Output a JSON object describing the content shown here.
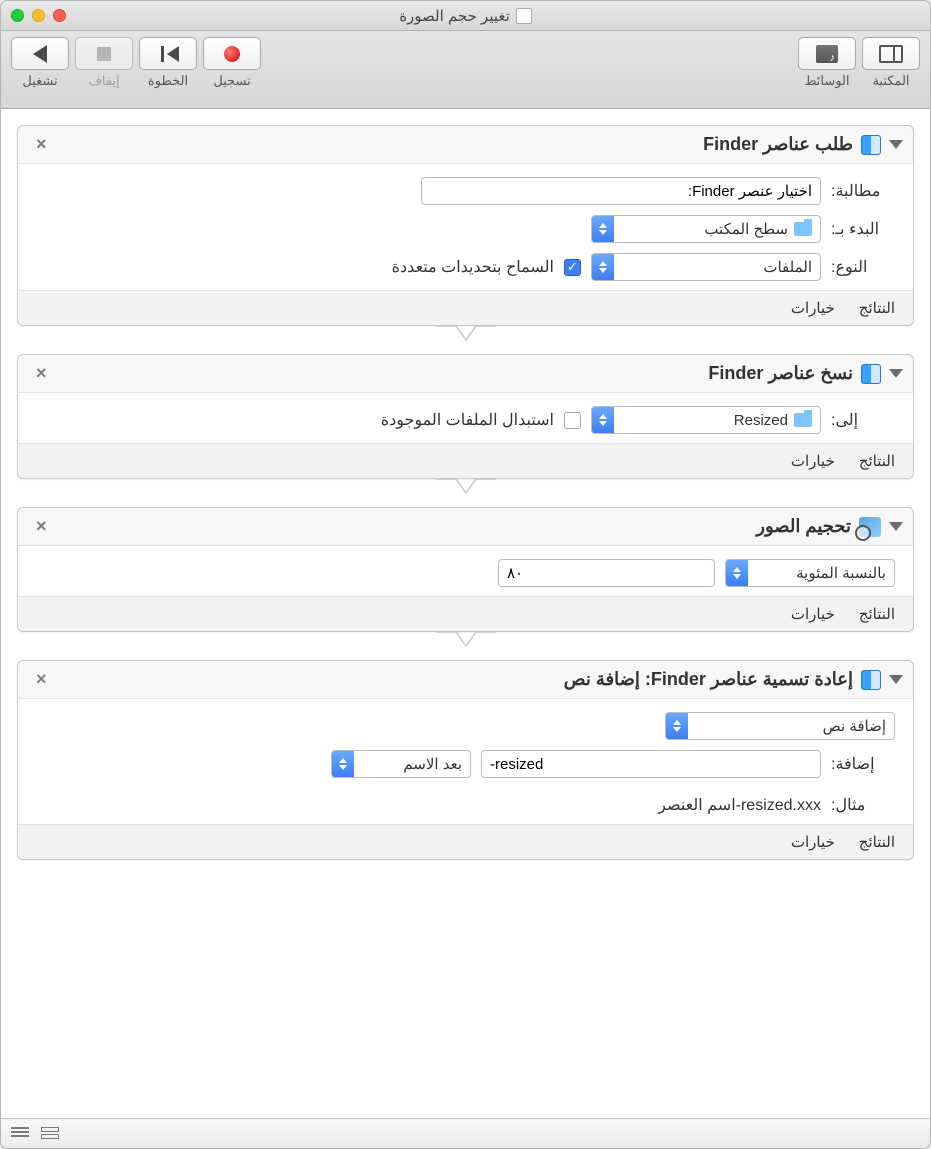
{
  "window": {
    "title": "تغيير حجم الصورة"
  },
  "toolbar": {
    "library": "المكتبة",
    "media": "الوسائط",
    "record": "تسجيل",
    "step": "الخطوة",
    "stop": "إيقاف",
    "run": "تشغيل"
  },
  "actions": [
    {
      "title": "طلب عناصر Finder",
      "icon": "finder",
      "prompt_label": "مطالبة:",
      "prompt_value": "اختيار عنصر Finder:",
      "start_label": "البدء بـ:",
      "start_value": "سطح المكتب",
      "type_label": "النوع:",
      "type_value": "الملفات",
      "allow_multi_label": "السماح بتحديدات متعددة",
      "allow_multi_checked": true,
      "results": "النتائج",
      "options": "خيارات"
    },
    {
      "title": "نسخ عناصر Finder",
      "icon": "finder",
      "to_label": "إلى:",
      "to_value": "Resized",
      "replace_label": "استبدال الملفات الموجودة",
      "replace_checked": false,
      "results": "النتائج",
      "options": "خيارات"
    },
    {
      "title": "تحجيم الصور",
      "icon": "preview",
      "mode_value": "بالنسبة المئوية",
      "amount_value": "٨٠",
      "results": "النتائج",
      "options": "خيارات"
    },
    {
      "title": "إعادة تسمية عناصر Finder: إضافة نص",
      "icon": "finder",
      "mode_value": "إضافة نص",
      "add_label": "إضافة:",
      "add_value": "-resized",
      "position_value": "بعد الاسم",
      "example_label": "مثال:",
      "example_value": "اسم العنصر-resized.xxx",
      "results": "النتائج",
      "options": "خيارات"
    }
  ]
}
